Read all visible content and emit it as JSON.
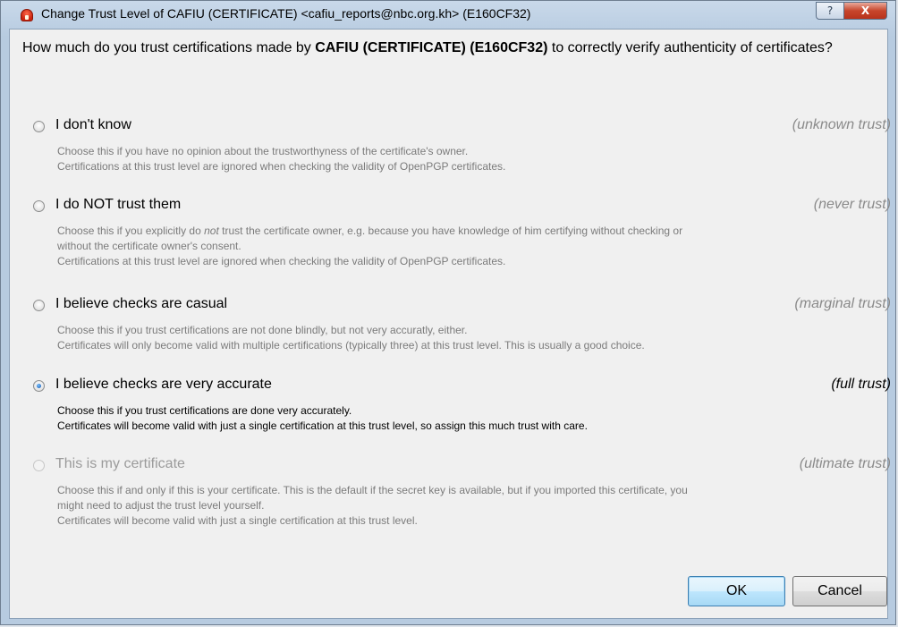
{
  "window": {
    "title": "Change Trust Level of CAFIU (CERTIFICATE) <cafiu_reports@nbc.org.kh> (E160CF32)",
    "help_label": "?",
    "close_label": "X"
  },
  "question": {
    "prefix": "How much do you trust certifications made by ",
    "name": "CAFIU (CERTIFICATE) (E160CF32)",
    "suffix": " to correctly verify authenticity of certificates?"
  },
  "options": [
    {
      "label": "I don't know",
      "trust": "(unknown trust)",
      "checked": false,
      "enabled": true,
      "desc": [
        "Choose this if you have no opinion about the trustworthyness of the certificate's owner.",
        "Certifications at this trust level are ignored when checking the validity of OpenPGP certificates."
      ]
    },
    {
      "label": "I do NOT trust them",
      "trust": "(never trust)",
      "checked": false,
      "enabled": true,
      "desc": [
        "Choose this if you explicitly do not trust the certificate owner, e.g. because you have knowledge of him certifying without checking or",
        "without the certificate owner's consent.",
        "Certifications at this trust level are ignored when checking the validity of OpenPGP certificates."
      ]
    },
    {
      "label": "I believe checks are casual",
      "trust": "(marginal trust)",
      "checked": false,
      "enabled": true,
      "desc": [
        "Choose this if you trust certifications are not done blindly, but not very accuratly, either.",
        "Certificates will only become valid with multiple certifications (typically three) at this trust level. This is usually a good choice."
      ]
    },
    {
      "label": "I believe checks are very accurate",
      "trust": "(full trust)",
      "checked": true,
      "enabled": true,
      "desc": [
        "Choose this if you trust certifications are done very accurately.",
        "Certificates will become valid with just a single certification at this trust level, so assign this much trust with care."
      ]
    },
    {
      "label": "This is my certificate",
      "trust": "(ultimate trust)",
      "checked": false,
      "enabled": false,
      "desc": [
        "Choose this if and only if this is your certificate. This is the default if the secret key is available, but if you imported this certificate, you",
        "might need to adjust the trust level yourself.",
        "Certificates will become valid with just a single certification at this trust level."
      ]
    }
  ],
  "buttons": {
    "ok": "OK",
    "cancel": "Cancel"
  }
}
